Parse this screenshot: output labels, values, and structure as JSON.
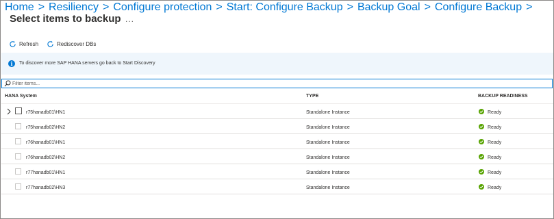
{
  "breadcrumb": {
    "items": [
      "Home",
      "Resiliency",
      "Configure protection",
      "Start: Configure Backup",
      "Backup Goal",
      "Configure Backup"
    ],
    "separator": ">"
  },
  "page": {
    "title": "Select items to backup",
    "more": "..."
  },
  "toolbar": {
    "refresh": "Refresh",
    "rediscover": "Rediscover DBs"
  },
  "info": {
    "text": "To discover more SAP HANA servers go back to Start Discovery",
    "icon": "info-icon"
  },
  "filter": {
    "placeholder": "Filter items..."
  },
  "table": {
    "headers": {
      "system": "HANA System",
      "type": "TYPE",
      "readiness": "BACKUP READINESS"
    },
    "rows": [
      {
        "system": "r75hanadb01\\HN1",
        "type": "Standalone Instance",
        "readiness": "Ready"
      },
      {
        "system": "r75hanadb02\\HN2",
        "type": "Standalone Instance",
        "readiness": "Ready"
      },
      {
        "system": "r76hanadb01\\HN1",
        "type": "Standalone Instance",
        "readiness": "Ready"
      },
      {
        "system": "r76hanadb02\\HN2",
        "type": "Standalone Instance",
        "readiness": "Ready"
      },
      {
        "system": "r77hanadb01\\HN1",
        "type": "Standalone Instance",
        "readiness": "Ready"
      },
      {
        "system": "r77hanadb02\\HN3",
        "type": "Standalone Instance",
        "readiness": "Ready"
      }
    ]
  },
  "colors": {
    "accent": "#0078d4",
    "info_bg": "#eff6fc",
    "ready": "#57a300"
  }
}
